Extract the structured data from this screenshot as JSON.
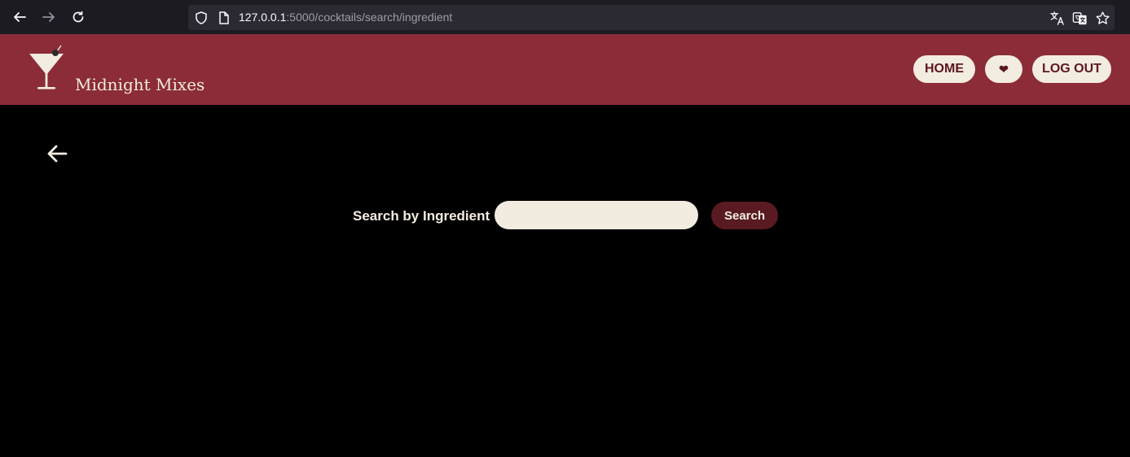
{
  "browser": {
    "url_host": "127.0.0.1",
    "url_path": ":5000/cocktails/search/ingredient",
    "icons": [
      "back-arrow-icon",
      "forward-arrow-icon",
      "reload-icon",
      "shield-icon",
      "page-icon",
      "translate-icon",
      "translate-page-icon",
      "star-icon"
    ]
  },
  "header": {
    "brand": "Midnight Mixes",
    "nav": {
      "home": "HOME",
      "favorites": "❤",
      "logout": "LOG OUT"
    }
  },
  "search": {
    "label": "Search by Ingredient",
    "value": "",
    "placeholder": "",
    "button": "Search"
  },
  "colors": {
    "header_bg": "#8b2c38",
    "cream": "#f3ece0",
    "dark_red": "#5a1a22",
    "page_bg": "#000000"
  }
}
